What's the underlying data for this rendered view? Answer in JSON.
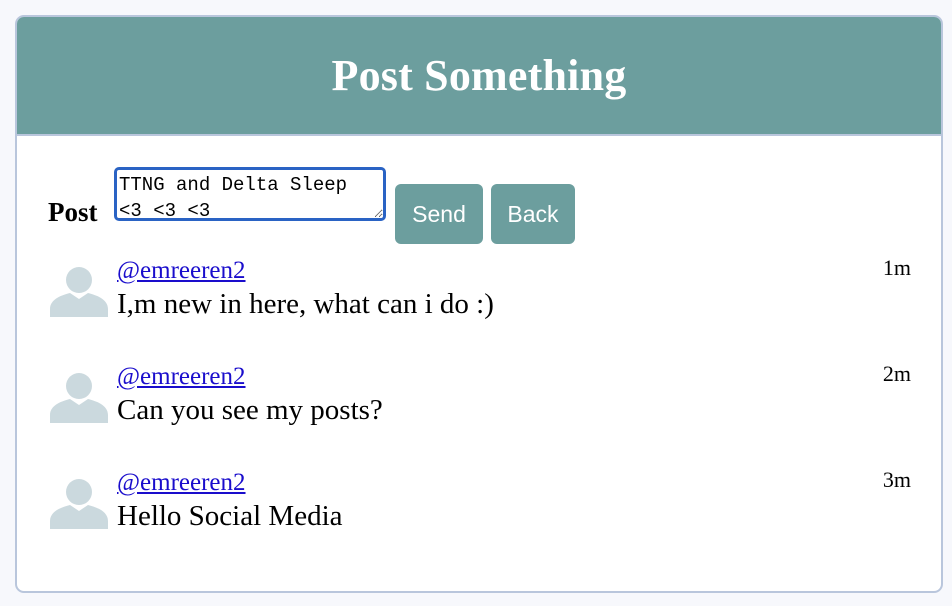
{
  "header": {
    "title": "Post Something"
  },
  "composer": {
    "label": "Post",
    "input_value": "TTNG and Delta Sleep <3 <3 <3",
    "send_label": "Send",
    "back_label": "Back"
  },
  "feed": {
    "items": [
      {
        "handle": "@emreeren2",
        "message": "I,m new in here, what can i do :)",
        "time": "1m"
      },
      {
        "handle": "@emreeren2",
        "message": "Can you see my posts?",
        "time": "2m"
      },
      {
        "handle": "@emreeren2",
        "message": "Hello Social Media",
        "time": "3m"
      }
    ]
  },
  "colors": {
    "accent": "#6c9e9e",
    "border": "#b9c6dc",
    "link": "#1a0dcc",
    "avatar": "#cbd9de",
    "focus": "#2a63c4"
  }
}
